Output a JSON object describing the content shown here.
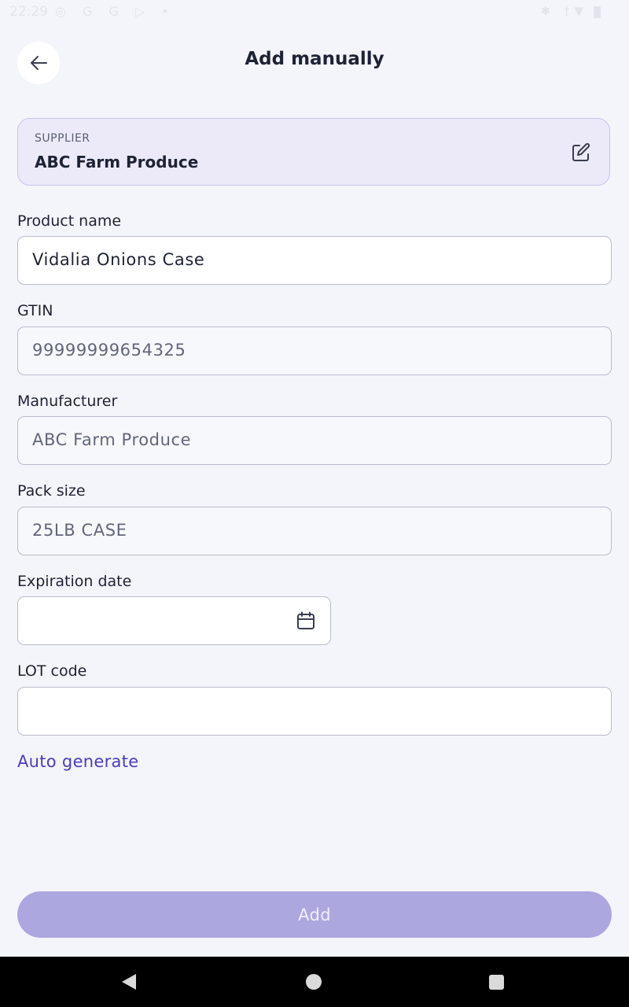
{
  "status_bar": {
    "time": "22:29",
    "left_icons": "◎ G G ▷ •",
    "right_icons": "✱ †▼"
  },
  "header": {
    "title": "Add manually",
    "back_icon": "arrow-left-icon"
  },
  "supplier": {
    "caption": "SUPPLIER",
    "name": "ABC Farm Produce",
    "edit_icon": "edit-icon"
  },
  "form": {
    "product_name": {
      "label": "Product name",
      "value": "Vidalia Onions Case"
    },
    "gtin": {
      "label": "GTIN",
      "value": "99999999654325"
    },
    "manufacturer": {
      "label": "Manufacturer",
      "value": "ABC Farm Produce"
    },
    "pack_size": {
      "label": "Pack size",
      "value": "25LB CASE"
    },
    "expiration_date": {
      "label": "Expiration date",
      "value": "",
      "icon": "calendar-icon"
    },
    "lot_code": {
      "label": "LOT code",
      "value": ""
    },
    "auto_generate_label": "Auto generate"
  },
  "actions": {
    "add_label": "Add"
  },
  "colors": {
    "accent": "#4A3CC0",
    "add_button_disabled": "#ADA7E0",
    "supplier_card_bg": "#ECEAF8",
    "background": "#F4F5FA"
  }
}
